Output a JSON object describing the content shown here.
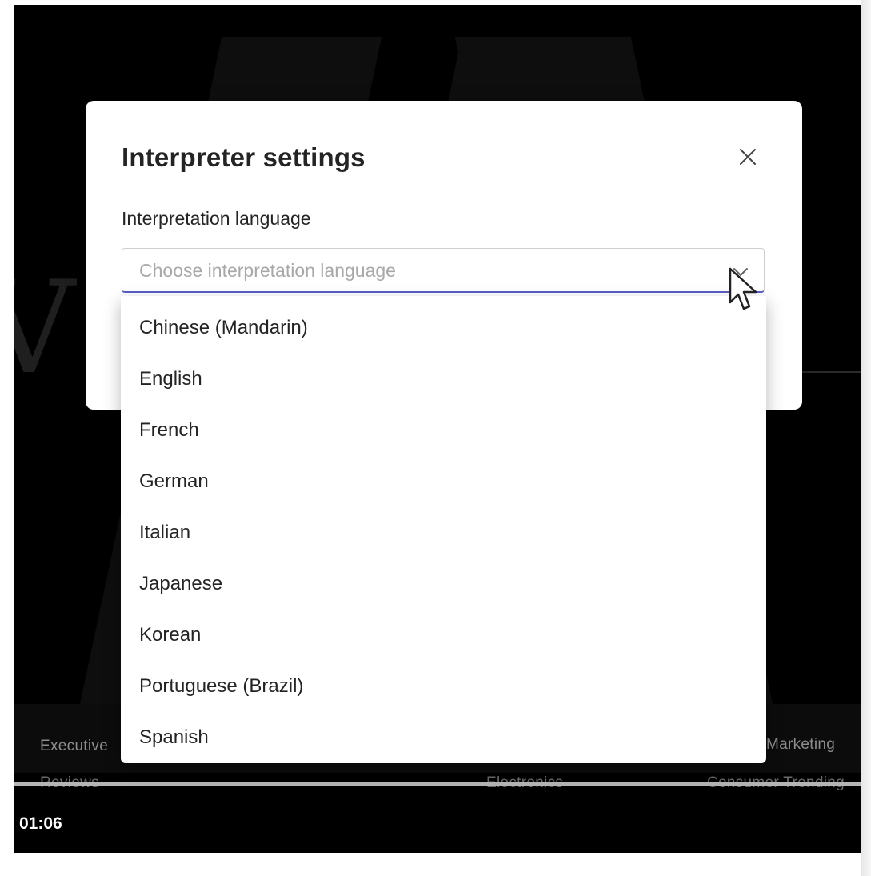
{
  "dialog": {
    "title": "Interpreter settings",
    "close_icon": "close-icon",
    "field_label": "Interpretation language",
    "select_placeholder": "Choose interpretation language",
    "chevron_icon": "chevron-down-icon",
    "accent_color": "#5b5fc7"
  },
  "dropdown": {
    "options": [
      "Chinese (Mandarin)",
      "English",
      "French",
      "German",
      "Italian",
      "Japanese",
      "Korean",
      "Portuguese (Brazil)",
      "Spanish"
    ]
  },
  "background": {
    "ticker_row1": [
      "Executive",
      "Marketing"
    ],
    "ticker_row2": [
      "Reviews",
      "Electronics",
      "Consumer Trending"
    ],
    "time": "01:06"
  }
}
